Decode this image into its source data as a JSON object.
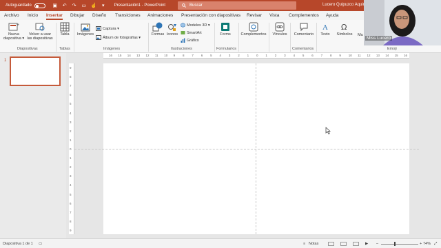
{
  "titlebar": {
    "autosave_label": "Autoguardado",
    "doc_title": "Presentación1 - PowerPoint",
    "search_placeholder": "Buscar",
    "user": "Lucero Quipuzco Aquino"
  },
  "tabs": [
    "Archivo",
    "Inicio",
    "Insertar",
    "Dibujar",
    "Diseño",
    "Transiciones",
    "Animaciones",
    "Presentación con diapositivas",
    "Revisar",
    "Vista",
    "Complementos",
    "Ayuda"
  ],
  "active_tab": "Insertar",
  "ribbon": {
    "nueva_diapositiva": [
      "Nueva",
      "diapositiva ▾"
    ],
    "volver_usar": [
      "Volver a usar",
      "las diapositivas"
    ],
    "group_diapositivas": "Diapositivas",
    "tabla": "Tabla",
    "group_tablas": "Tablas",
    "imagenes": "Imágenes",
    "captura": "Captura ▾",
    "album": "Álbum de fotografías ▾",
    "group_imagenes": "Imágenes",
    "formas": "Formas",
    "iconos": "Iconos",
    "modelos3d": "Modelos 3D ▾",
    "smartart": "SmartArt",
    "grafico": "Gráfico",
    "group_ilustraciones": "Ilustraciones",
    "forms": "Forms",
    "group_formularios": "Formularios",
    "complementos": "Complementos",
    "vinculos": "Vínculos",
    "comentario": "Comentario",
    "group_comentarios": "Comentarios",
    "texto": "Texto",
    "simbolos": "Símbolos",
    "multimedia": "Mu",
    "group_emoji": "Emoji"
  },
  "slides": {
    "number": "1"
  },
  "ruler": {
    "h_ticks": [
      "16",
      "15",
      "14",
      "13",
      "12",
      "11",
      "10",
      "9",
      "8",
      "7",
      "6",
      "5",
      "4",
      "3",
      "2",
      "1",
      "0",
      "1",
      "2",
      "3",
      "4",
      "5",
      "6",
      "7",
      "8",
      "9",
      "10",
      "11",
      "12",
      "13",
      "14",
      "15",
      "16"
    ],
    "v_ticks": [
      "9",
      "8",
      "7",
      "6",
      "5",
      "4",
      "3",
      "2",
      "1",
      "0",
      "1",
      "2",
      "3",
      "4",
      "5",
      "6",
      "7",
      "8",
      "9"
    ]
  },
  "status": {
    "slide_info": "Diapositiva 1 de 1",
    "notes": "Notas",
    "zoom": "74%"
  },
  "overlay": {
    "zoom_brand": "zoom",
    "cam_name": "Miss Lucero"
  },
  "colors": {
    "accent": "#b7472a"
  }
}
